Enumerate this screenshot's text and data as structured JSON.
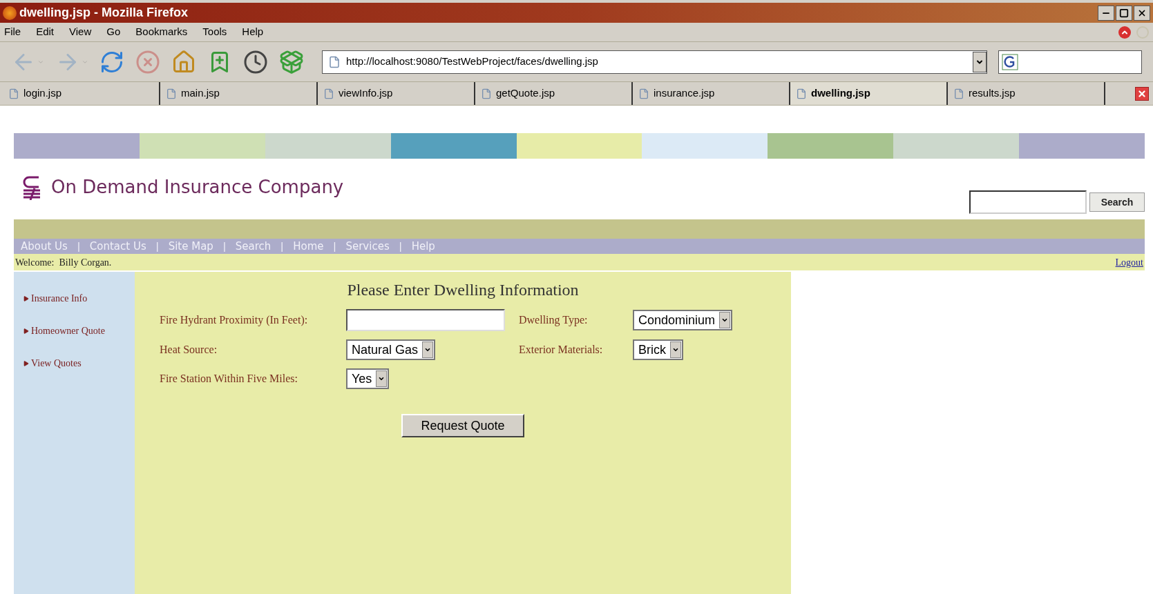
{
  "window": {
    "title": "dwelling.jsp - Mozilla Firefox"
  },
  "menu": [
    "File",
    "Edit",
    "View",
    "Go",
    "Bookmarks",
    "Tools",
    "Help"
  ],
  "toolbar": [
    {
      "kind": "back",
      "disabled": true
    },
    {
      "kind": "forward",
      "disabled": true
    },
    {
      "kind": "reload",
      "disabled": false
    },
    {
      "kind": "stop",
      "disabled": true
    },
    {
      "kind": "home",
      "disabled": false
    },
    {
      "kind": "bookmark",
      "disabled": false
    },
    {
      "kind": "history",
      "disabled": false
    },
    {
      "kind": "download",
      "disabled": false
    }
  ],
  "address": {
    "value": "http://localhost:9080/TestWebProject/faces/dwelling.jsp"
  },
  "tabs": [
    {
      "label": "login.jsp",
      "selected": false
    },
    {
      "label": "main.jsp",
      "selected": false
    },
    {
      "label": "viewInfo.jsp",
      "selected": false
    },
    {
      "label": "getQuote.jsp",
      "selected": false
    },
    {
      "label": "insurance.jsp",
      "selected": false
    },
    {
      "label": "dwelling.jsp",
      "selected": true
    },
    {
      "label": "results.jsp",
      "selected": false
    }
  ],
  "header": {
    "company": "On Demand Insurance Company",
    "search_button": "Search"
  },
  "nav": [
    {
      "kind": "link",
      "label": "About Us"
    },
    {
      "kind": "separator",
      "label": "|"
    },
    {
      "kind": "link",
      "label": "Contact Us"
    },
    {
      "kind": "separator",
      "label": "|"
    },
    {
      "kind": "link",
      "label": "Site Map"
    },
    {
      "kind": "separator",
      "label": "|"
    },
    {
      "kind": "link",
      "label": "Search"
    },
    {
      "kind": "separator",
      "label": "|"
    },
    {
      "kind": "link",
      "label": "Home"
    },
    {
      "kind": "separator",
      "label": "|"
    },
    {
      "kind": "link",
      "label": "Services"
    },
    {
      "kind": "separator",
      "label": "|"
    },
    {
      "kind": "link",
      "label": "Help"
    }
  ],
  "welcome": "Welcome:  Billy Corgan.",
  "logout": "Logout",
  "sidebar": {
    "items": [
      "Insurance Info",
      "Homeowner Quote",
      "View Quotes"
    ]
  },
  "form": {
    "title": "Please Enter Dwelling Information",
    "fields": [
      {
        "label": "Fire Hydrant Proximity (In Feet):",
        "kind": "text"
      },
      {
        "label": "Dwelling Type:",
        "kind": "select",
        "value": "Condominium"
      },
      {
        "label": "Heat Source:",
        "kind": "select",
        "value": "Natural Gas"
      },
      {
        "label": "Exterior Materials:",
        "kind": "select",
        "value": "Brick"
      },
      {
        "label": "Fire Station Within Five Miles:",
        "kind": "select",
        "value": "Yes"
      }
    ],
    "submit": "Request Quote"
  }
}
